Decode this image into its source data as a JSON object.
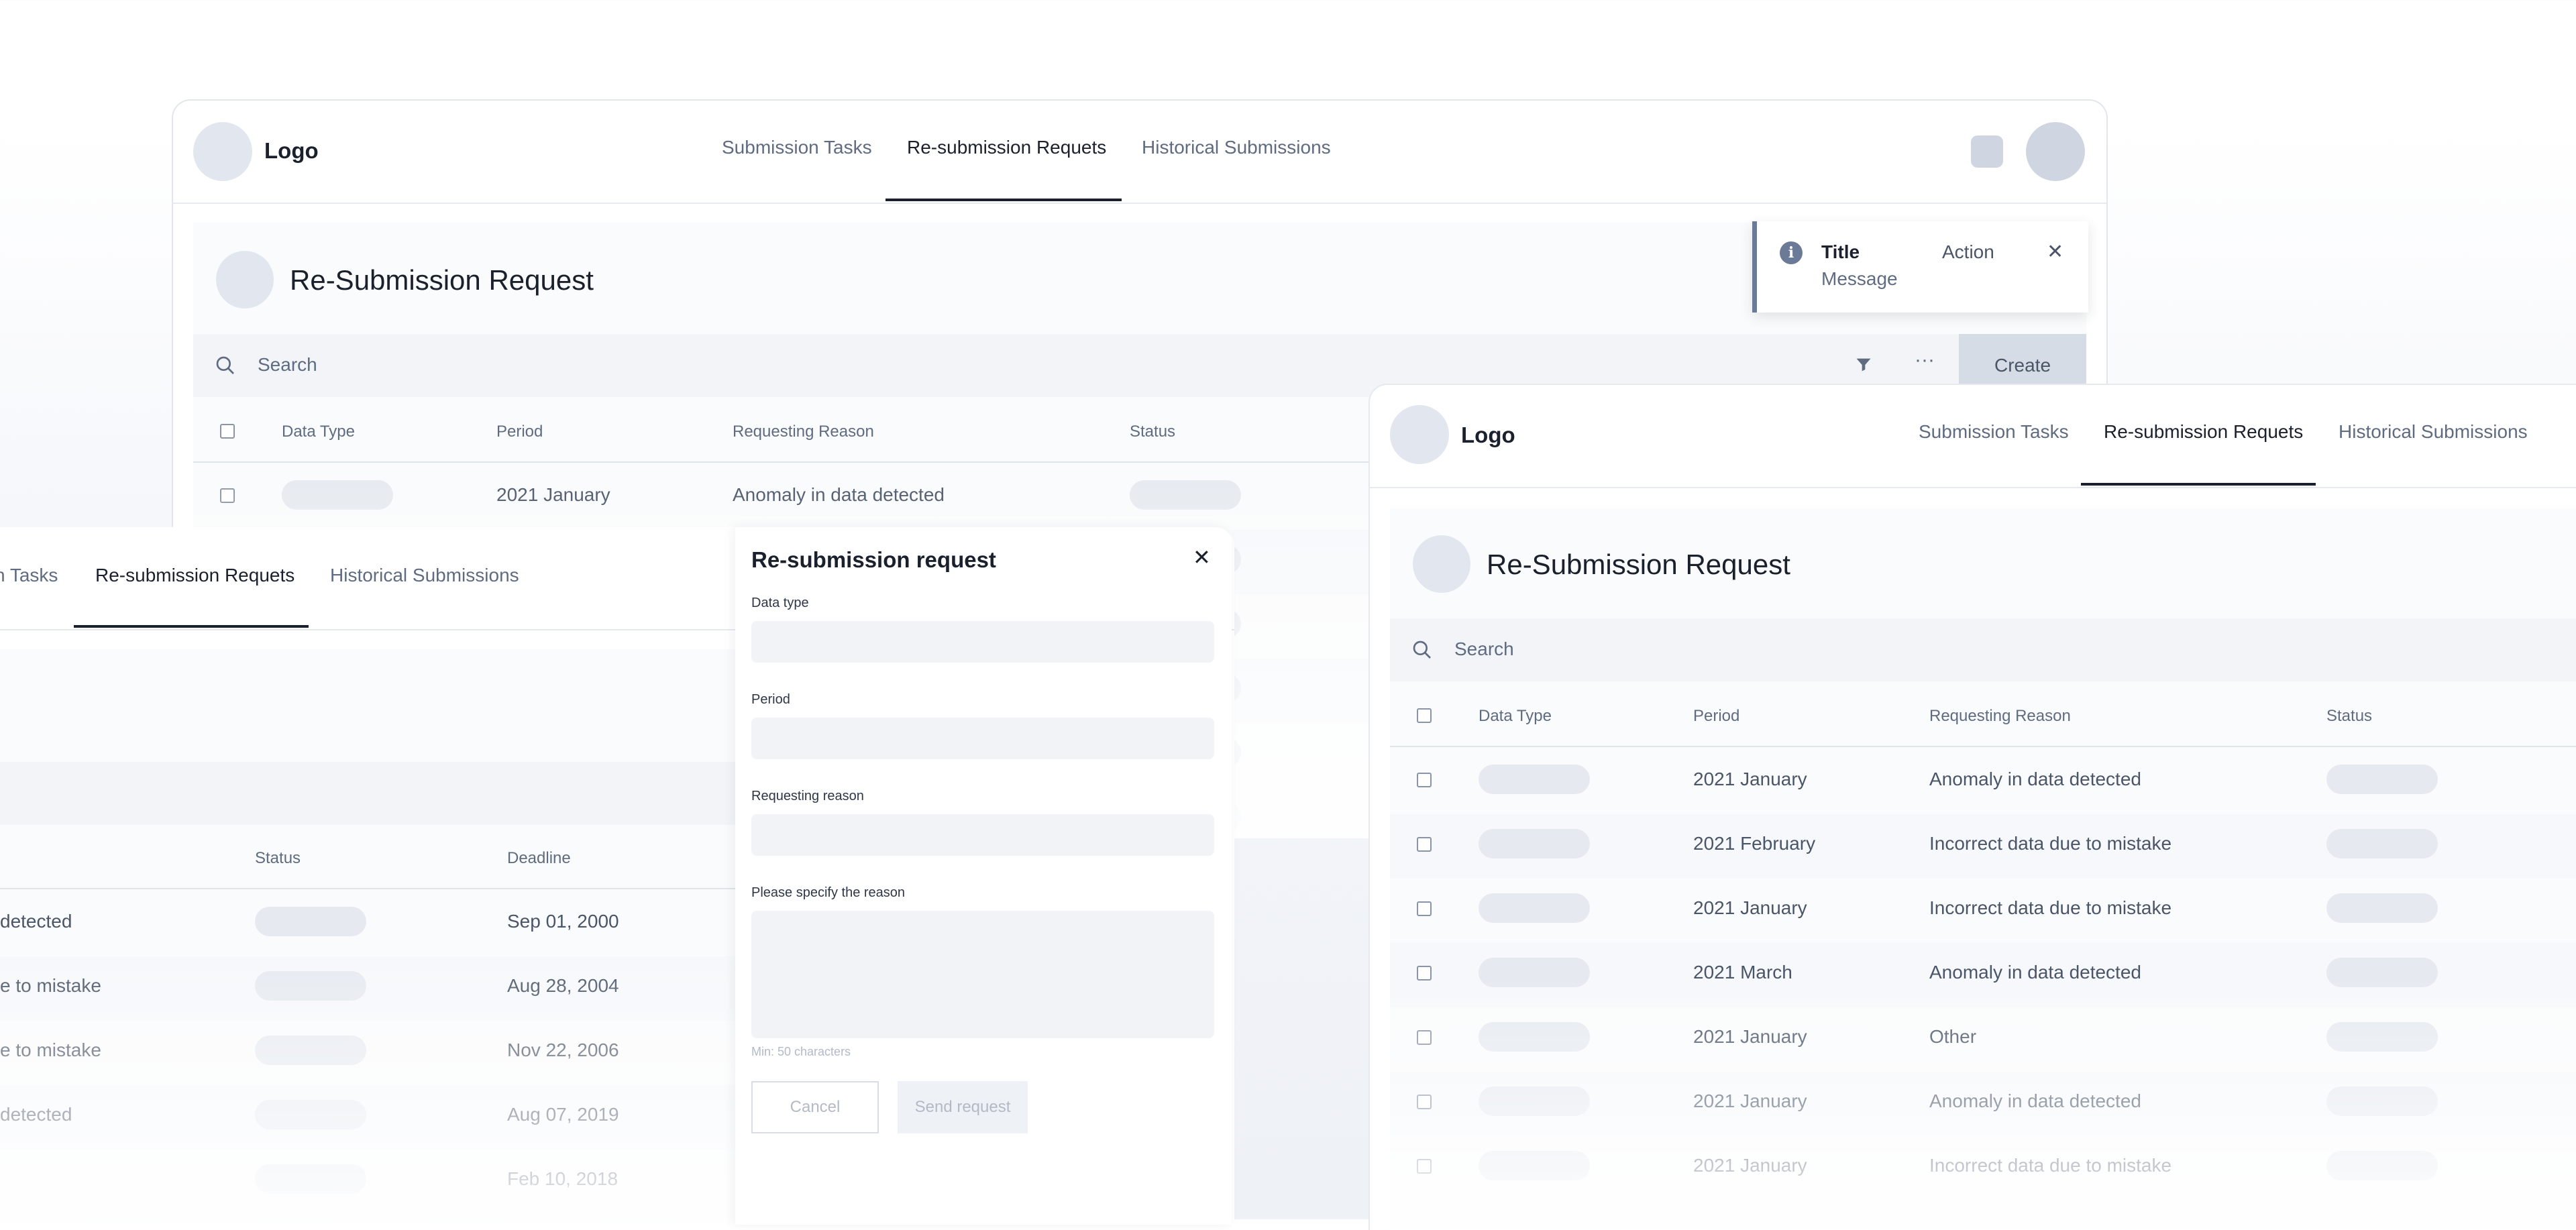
{
  "app": {
    "logo_text": "Logo",
    "tabs": [
      "Submission Tasks",
      "Re-submission Requets",
      "Historical Submissions"
    ]
  },
  "page": {
    "title": "Re-Submission Request",
    "search_placeholder": "Search",
    "create_label": "Create",
    "more_icon": "···"
  },
  "table": {
    "headers": {
      "data_type": "Data Type",
      "period": "Period",
      "reason": "Requesting Reason",
      "status": "Status",
      "deadline": "Deadline"
    },
    "rows": [
      {
        "period": "2021 January",
        "reason": "Anomaly in data detected"
      },
      {
        "period": "2021 February",
        "reason": "Incorrect data due to mistake"
      },
      {
        "period": "2021 January",
        "reason": "Incorrect data due to mistake"
      },
      {
        "period": "2021 March",
        "reason": "Anomaly in data detected"
      },
      {
        "period": "2021 January",
        "reason": "Other"
      },
      {
        "period": "2021 January",
        "reason": "Anomaly in data detected"
      },
      {
        "period": "2021 January",
        "reason": "Incorrect data due to mistake"
      }
    ]
  },
  "left_panel": {
    "tabs": [
      "n Tasks",
      "Re-submission Requets",
      "Historical Submissions"
    ],
    "rows": [
      {
        "reason_fragment": "detected",
        "deadline": "Sep 01, 2000"
      },
      {
        "reason_fragment": "e to mistake",
        "deadline": "Aug 28, 2004"
      },
      {
        "reason_fragment": "e to mistake",
        "deadline": "Nov 22, 2006"
      },
      {
        "reason_fragment": "detected",
        "deadline": "Aug 07, 2019"
      },
      {
        "reason_fragment": "",
        "deadline": "Feb 10, 2018"
      }
    ]
  },
  "toast": {
    "title": "Title",
    "message": "Message",
    "action": "Action",
    "close_glyph": "✕",
    "icon_glyph": "i"
  },
  "modal": {
    "title": "Re-submission request",
    "close_glyph": "✕",
    "labels": {
      "data_type": "Data type",
      "period": "Period",
      "reason": "Requesting reason",
      "specify": "Please specify the reason"
    },
    "hint": "Min: 50 characters",
    "cancel_label": "Cancel",
    "send_label": "Send request"
  },
  "colors": {
    "accent": "#1a202c",
    "muted_text": "#5f6b81",
    "skeleton": "#e6eaf0",
    "toast_accent": "#6b7a96"
  }
}
